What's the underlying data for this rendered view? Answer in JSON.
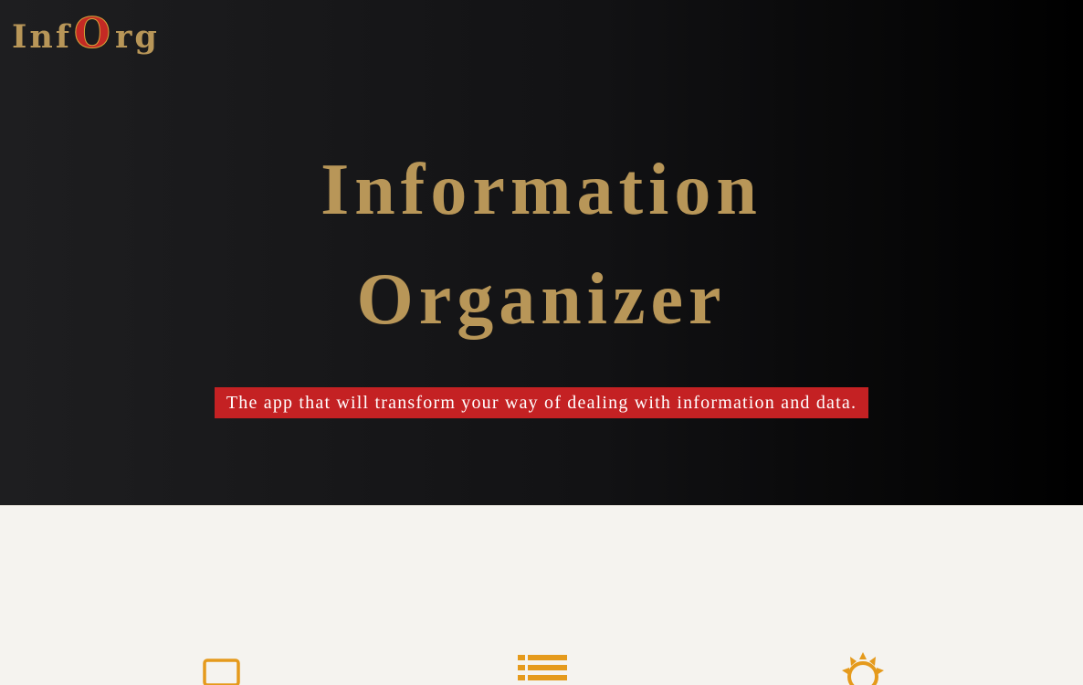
{
  "logo": {
    "part1": "Inf",
    "big_letter": "O",
    "part2": "rg"
  },
  "hero": {
    "title_line1": "Information",
    "title_line2": "Organizer",
    "tagline": "The app that will transform your way of dealing with information and data."
  },
  "features": {
    "icons": [
      "laptop-icon",
      "list-icon",
      "sun-icon"
    ]
  },
  "colors": {
    "gold": "#b89658",
    "red": "#c42123",
    "orange": "#e59a1c",
    "dark": "#000000",
    "light": "#f5f3ef"
  }
}
